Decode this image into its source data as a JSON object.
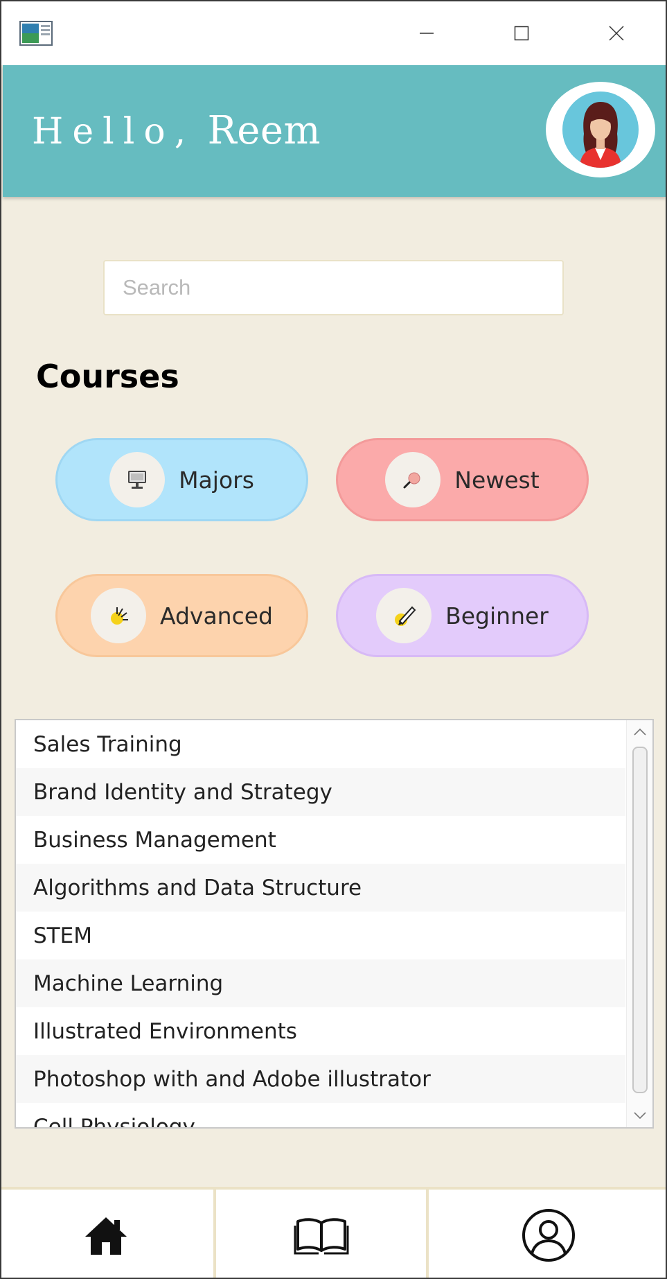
{
  "window": {
    "app_icon": "app-window-icon",
    "controls": {
      "minimize": "minimize-icon",
      "maximize": "maximize-icon",
      "close": "close-icon"
    }
  },
  "header": {
    "greeting_word": "Hello,",
    "user_name": "Reem",
    "avatar": "user-avatar"
  },
  "search": {
    "placeholder": "Search",
    "value": ""
  },
  "courses": {
    "title": "Courses",
    "categories": [
      {
        "label": "Majors",
        "icon": "computer-icon",
        "color": "#b1e4fb"
      },
      {
        "label": "Newest",
        "icon": "magnifier-icon",
        "color": "#fbaaaa"
      },
      {
        "label": "Advanced",
        "icon": "lightbulb-icon",
        "color": "#fdd3ad"
      },
      {
        "label": "Beginner",
        "icon": "pencil-icon",
        "color": "#e3cbfb"
      }
    ],
    "list": [
      "Sales Training",
      "Brand Identity and Strategy",
      "Business Management",
      "Algorithms and Data Structure",
      "STEM",
      "Machine Learning",
      "Illustrated Environments",
      "Photoshop with and Adobe illustrator",
      "Cell Physiology"
    ]
  },
  "bottom_nav": [
    {
      "name": "home",
      "icon": "home-icon"
    },
    {
      "name": "courses",
      "icon": "book-icon"
    },
    {
      "name": "profile",
      "icon": "user-circle-icon"
    }
  ],
  "colors": {
    "header": "#66bcc0",
    "background": "#f2ede0",
    "nav_border": "#ebe2c6"
  }
}
